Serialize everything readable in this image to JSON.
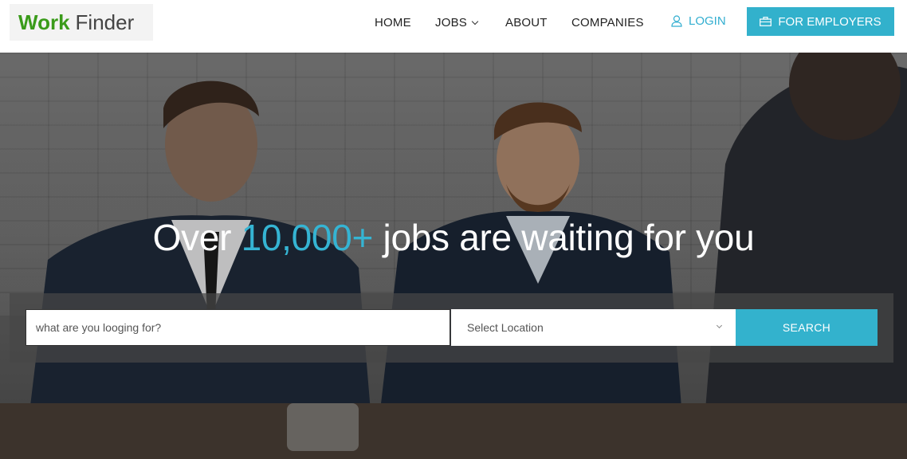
{
  "logo": {
    "part1": "Work",
    "part2": "Finder"
  },
  "nav": {
    "home": "HOME",
    "jobs": "JOBS",
    "about": "ABOUT",
    "companies": "COMPANIES",
    "login": "LOGIN",
    "employers": "FOR EMPLOYERS"
  },
  "hero": {
    "headline_before": "Over ",
    "headline_highlight": "10,000+",
    "headline_after": " jobs are waiting for you"
  },
  "search": {
    "placeholder": "what are you looging for?",
    "location_selected": "Select Location",
    "button": "SEARCH"
  },
  "colors": {
    "accent": "#33b2cd",
    "logo_green": "#3a9b1a"
  },
  "icons": {
    "login": "user-icon",
    "employers": "briefcase-icon",
    "jobs_dropdown": "chevron-down-icon",
    "location_dropdown": "chevron-down-icon"
  }
}
